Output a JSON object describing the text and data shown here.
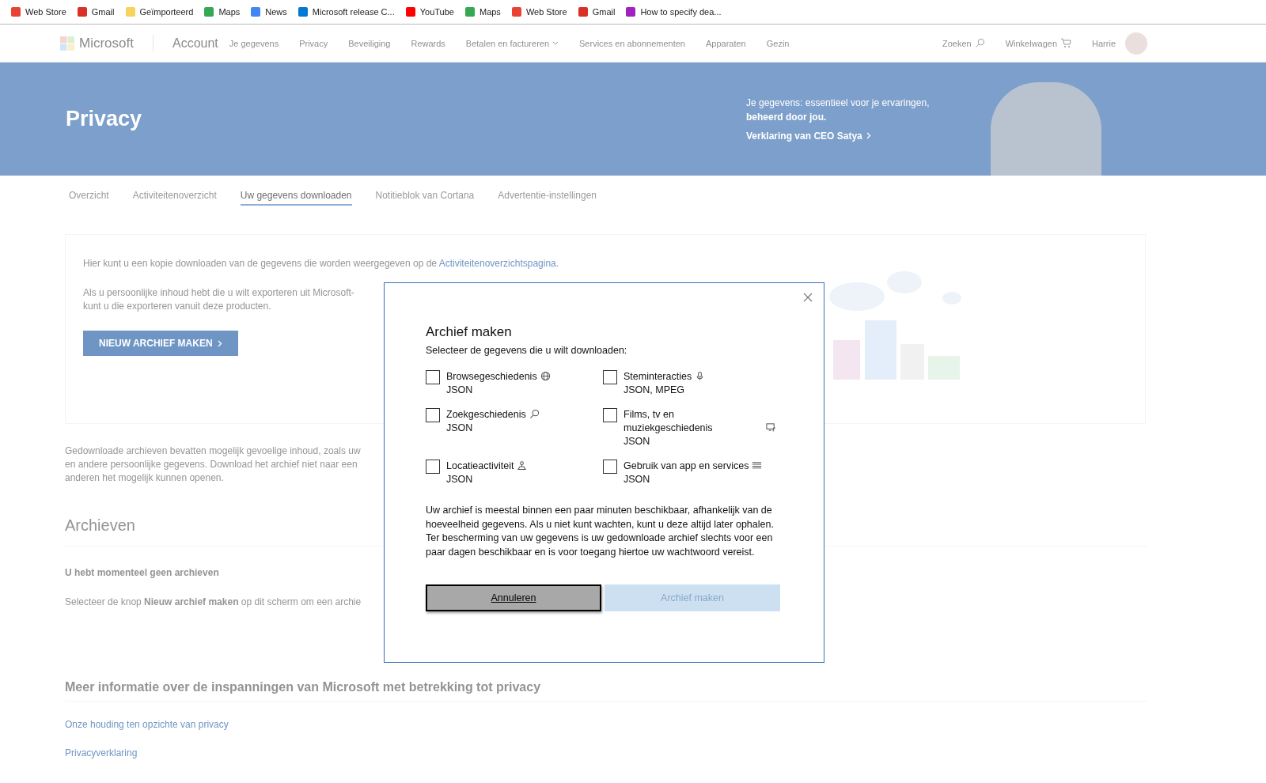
{
  "bookmarks": [
    {
      "label": "Web Store",
      "color": "#e94235"
    },
    {
      "label": "Gmail",
      "color": "#d93025"
    },
    {
      "label": "Geïmporteerd",
      "color": "#f6d35b"
    },
    {
      "label": "Maps",
      "color": "#34a853"
    },
    {
      "label": "News",
      "color": "#4285f4"
    },
    {
      "label": "Microsoft release C...",
      "color": "#0078d4"
    },
    {
      "label": "YouTube",
      "color": "#ff0000"
    },
    {
      "label": "Maps",
      "color": "#34a853"
    },
    {
      "label": "Web Store",
      "color": "#e94235"
    },
    {
      "label": "Gmail",
      "color": "#d93025"
    },
    {
      "label": "How to specify dea...",
      "color": "#a020c0"
    }
  ],
  "nav": {
    "brand": "Microsoft",
    "section": "Account",
    "links": [
      {
        "label": "Je gegevens",
        "dropdown": false
      },
      {
        "label": "Privacy",
        "dropdown": false
      },
      {
        "label": "Beveiliging",
        "dropdown": false
      },
      {
        "label": "Rewards",
        "dropdown": false
      },
      {
        "label": "Betalen en factureren",
        "dropdown": true
      },
      {
        "label": "Services en abonnementen",
        "dropdown": false
      },
      {
        "label": "Apparaten",
        "dropdown": false
      },
      {
        "label": "Gezin",
        "dropdown": false
      }
    ],
    "search": "Zoeken",
    "cart": "Winkelwagen",
    "user": "Harrie"
  },
  "hero": {
    "title": "Privacy",
    "tagline": "Je gegevens: essentieel voor je ervaringen,",
    "tagline_bold": "beheerd door jou.",
    "link": "Verklaring van CEO Satya"
  },
  "tabs": [
    {
      "label": "Overzicht",
      "selected": false
    },
    {
      "label": "Activiteitenoverzicht",
      "selected": false
    },
    {
      "label": "Uw gegevens downloaden",
      "selected": true
    },
    {
      "label": "Notitieblok van Cortana",
      "selected": false
    },
    {
      "label": "Advertentie-instellingen",
      "selected": false
    }
  ],
  "card": {
    "intro": "Hier kunt u een kopie downloaden van de gegevens die worden weergegeven op de",
    "intro_link": "Activiteitenoverzichtspagina",
    "intro_end": ".",
    "export_lines": [
      "Als u persoonlijke inhoud hebt die u wilt exporteren uit Microsoft-",
      "kunt u die exporteren vanuit deze producten."
    ],
    "button": "NIEUW ARCHIEF MAKEN"
  },
  "warning_lines": [
    "Gedownloade archieven bevatten mogelijk gevoelige inhoud, zoals uw",
    "en andere persoonlijke gegevens. Download het archief niet naar een",
    "anderen het mogelijk kunnen openen."
  ],
  "archives": {
    "heading": "Archieven",
    "empty": "U hebt momenteel geen archieven",
    "hint": "Selecteer de knop **Nieuw archief maken** op dit scherm om een archie"
  },
  "more": {
    "heading": "Meer informatie over de inspanningen van Microsoft met betrekking tot privacy",
    "links": [
      "Onze houding ten opzichte van privacy",
      "Privacyverklaring"
    ]
  },
  "dialog": {
    "title": "Archief maken",
    "subtitle": "Selecteer de gegevens die u wilt downloaden:",
    "options": [
      {
        "label": "Browsegeschiedenis",
        "formats": "JSON",
        "checked": false,
        "kind": "globe"
      },
      {
        "label": "Steminteracties",
        "formats": "JSON, MPEG",
        "checked": false,
        "kind": "mic"
      },
      {
        "label": "Zoekgeschiedenis",
        "formats": "JSON",
        "checked": false,
        "kind": "search"
      },
      {
        "label": "Films, tv en muziekgeschiedenis",
        "formats": "JSON",
        "checked": false,
        "kind": "media"
      },
      {
        "label": "Locatieactiviteit",
        "formats": "JSON",
        "checked": false,
        "kind": "location"
      },
      {
        "label": "Gebruik van app en services",
        "formats": "JSON",
        "checked": false,
        "kind": "list"
      }
    ],
    "note": "Uw archief is meestal binnen een paar minuten beschikbaar, afhankelijk van de hoeveelheid gegevens. Als u niet kunt wachten, kunt u deze altijd later ophalen. Ter bescherming van uw gegevens is uw gedownloade archief slechts voor een paar dagen beschikbaar en is voor toegang hiertoe uw wachtwoord vereist.",
    "buttons": [
      {
        "label": "Annuleren",
        "kind": "secondary",
        "focused": true,
        "disabled": false
      },
      {
        "label": "Archief maken",
        "kind": "primary",
        "focused": false,
        "disabled": true
      }
    ]
  }
}
